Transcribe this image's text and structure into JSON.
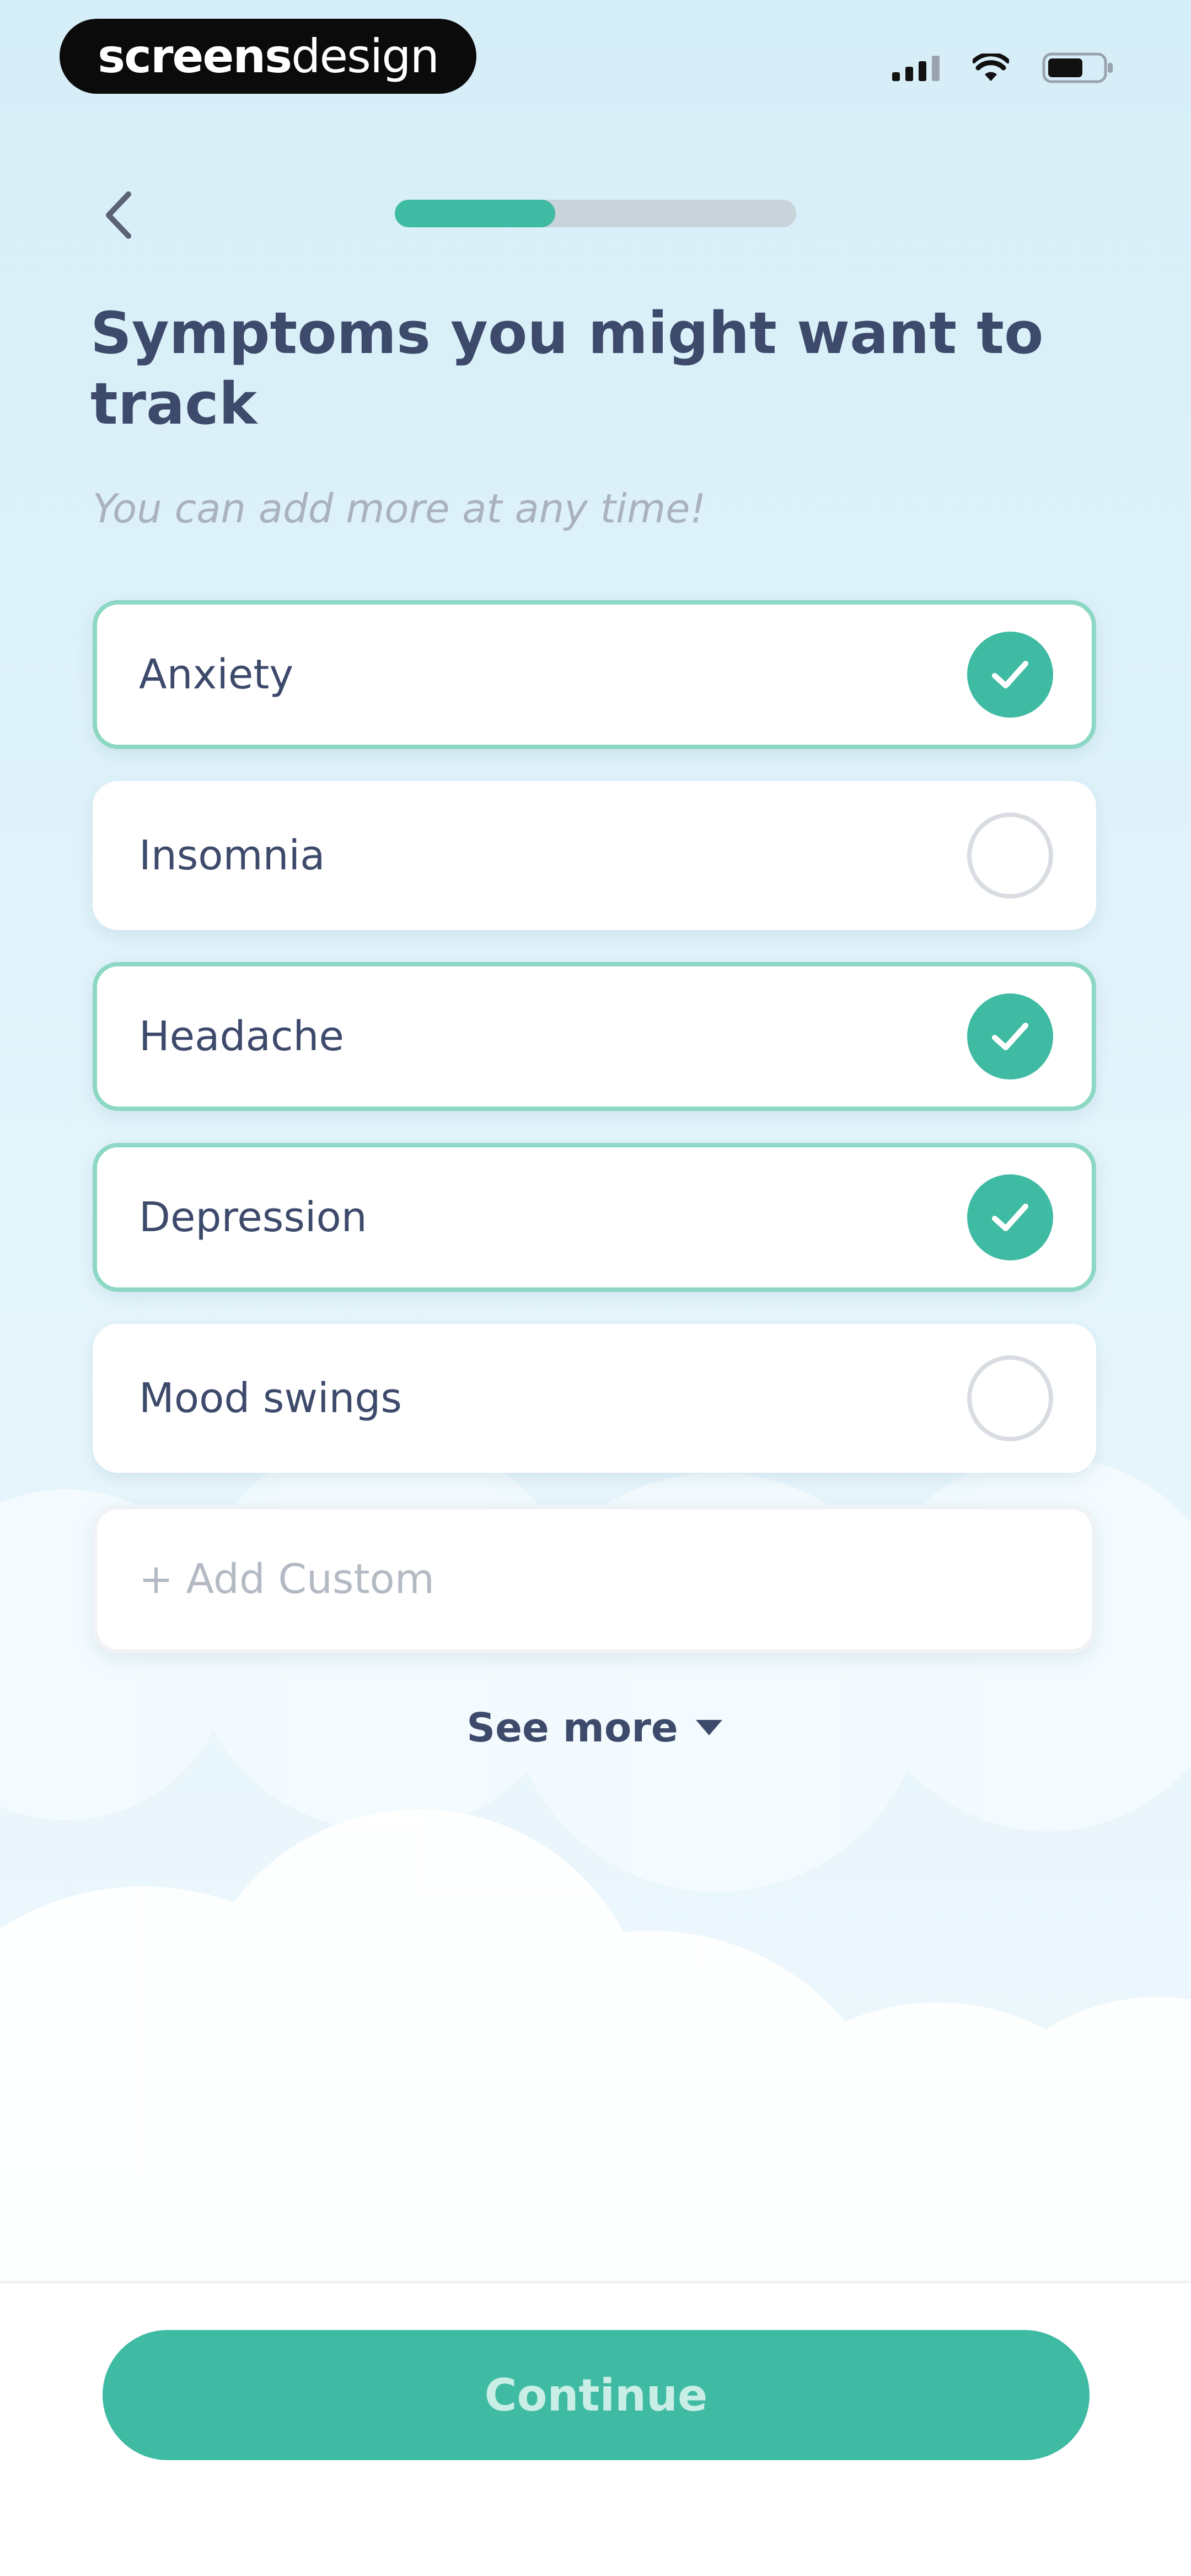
{
  "status_bar": {
    "brand_bold": "screens",
    "brand_light": "design",
    "icons": [
      "signal-icon",
      "wifi-icon",
      "battery-icon"
    ]
  },
  "header": {
    "back_icon": "chevron-left-icon",
    "progress_fraction": 0.4
  },
  "title": "Symptoms you might want to track",
  "subtitle": "You can add more at any time!",
  "options": [
    {
      "label": "Anxiety",
      "selected": true
    },
    {
      "label": "Insomnia",
      "selected": false
    },
    {
      "label": "Headache",
      "selected": true
    },
    {
      "label": "Depression",
      "selected": true
    },
    {
      "label": "Mood swings",
      "selected": false
    }
  ],
  "add_custom": "+ Add Custom",
  "see_more": "See more",
  "continue_label": "Continue",
  "colors": {
    "accent": "#3fbaa3",
    "text": "#3d4a6b",
    "muted": "#aab1c0"
  }
}
